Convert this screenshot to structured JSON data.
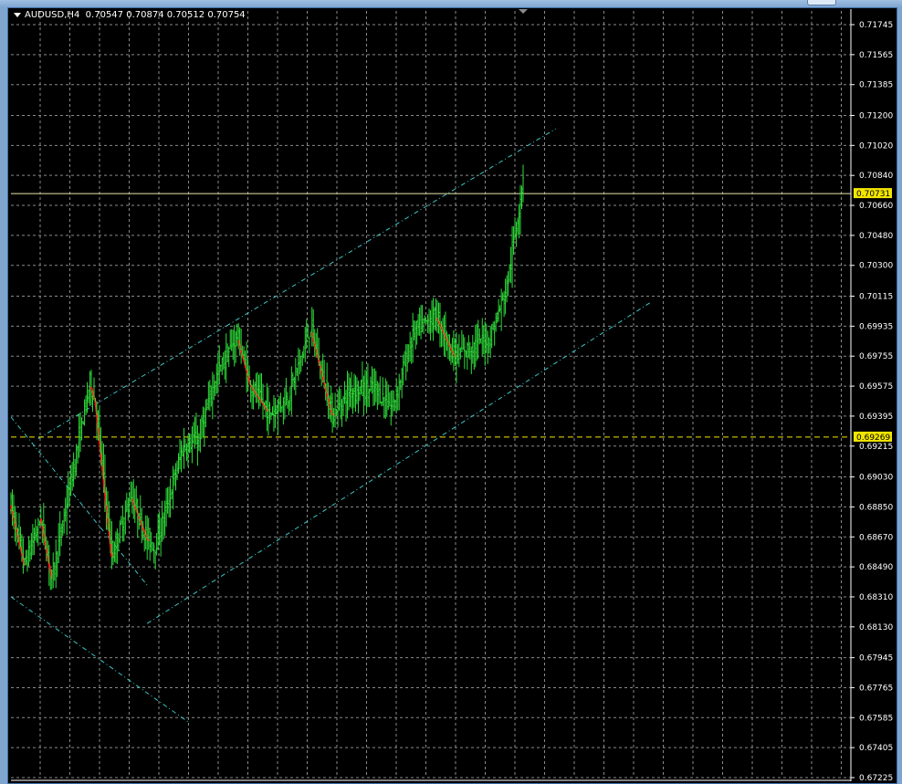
{
  "window": {
    "symbol": "AUDUSD",
    "timeframe": "H4",
    "ohlc": [
      "0.70547",
      "0.70874",
      "0.70512",
      "0.70754"
    ]
  },
  "colors": {
    "background": "#000000",
    "grid": "#8a8a8a",
    "bull": "#2fdc3a",
    "bear": "#ff1a1a",
    "channel": "#3cc4c4",
    "hline": "#f2e600"
  },
  "chart_data": {
    "type": "candlestick",
    "symbol": "AUDUSD",
    "timeframe": "H4",
    "ylim": [
      0.67225,
      0.71745
    ],
    "y_ticks": [
      "0.71745",
      "0.71565",
      "0.71385",
      "0.71200",
      "0.71020",
      "0.70840",
      "0.70660",
      "0.70480",
      "0.70300",
      "0.70115",
      "0.69935",
      "0.69755",
      "0.69575",
      "0.69395",
      "0.69215",
      "0.69030",
      "0.68850",
      "0.68670",
      "0.68490",
      "0.68310",
      "0.68130",
      "0.67945",
      "0.67765",
      "0.67585",
      "0.67405",
      "0.67225"
    ],
    "grid": true,
    "price_lines": [
      {
        "label": "0.70731",
        "value": 0.70731,
        "style": "solid"
      },
      {
        "label": "0.69269",
        "value": 0.69269,
        "style": "dashed"
      }
    ],
    "bar_count": 200,
    "price_path": [
      [
        0,
        0.6886
      ],
      [
        10,
        0.685
      ],
      [
        22,
        0.6878
      ],
      [
        30,
        0.6842
      ],
      [
        44,
        0.69
      ],
      [
        58,
        0.696
      ],
      [
        62,
        0.6948
      ],
      [
        74,
        0.6855
      ],
      [
        88,
        0.6892
      ],
      [
        100,
        0.6866
      ],
      [
        106,
        0.6862
      ],
      [
        112,
        0.6878
      ],
      [
        126,
        0.692
      ],
      [
        138,
        0.6926
      ],
      [
        150,
        0.6962
      ],
      [
        166,
        0.6988
      ],
      [
        176,
        0.6958
      ],
      [
        190,
        0.6941
      ],
      [
        204,
        0.6952
      ],
      [
        220,
        0.6993
      ],
      [
        236,
        0.694
      ],
      [
        250,
        0.6956
      ],
      [
        268,
        0.6955
      ],
      [
        280,
        0.6945
      ],
      [
        296,
        0.699
      ],
      [
        312,
        0.7
      ],
      [
        326,
        0.6975
      ],
      [
        340,
        0.6982
      ],
      [
        352,
        0.6987
      ],
      [
        364,
        0.7017
      ],
      [
        374,
        0.707
      ],
      [
        376,
        0.7085
      ]
    ],
    "trend_channel": {
      "upper": [
        [
          20,
          0.6926
        ],
        [
          400,
          0.7112
        ]
      ],
      "lower": [
        [
          100,
          0.6815
        ],
        [
          470,
          0.7008
        ]
      ]
    },
    "descending_channel": {
      "upper": [
        [
          0,
          0.6939
        ],
        [
          100,
          0.6838
        ]
      ],
      "lower": [
        [
          0,
          0.6831
        ],
        [
          130,
          0.6756
        ]
      ]
    }
  }
}
